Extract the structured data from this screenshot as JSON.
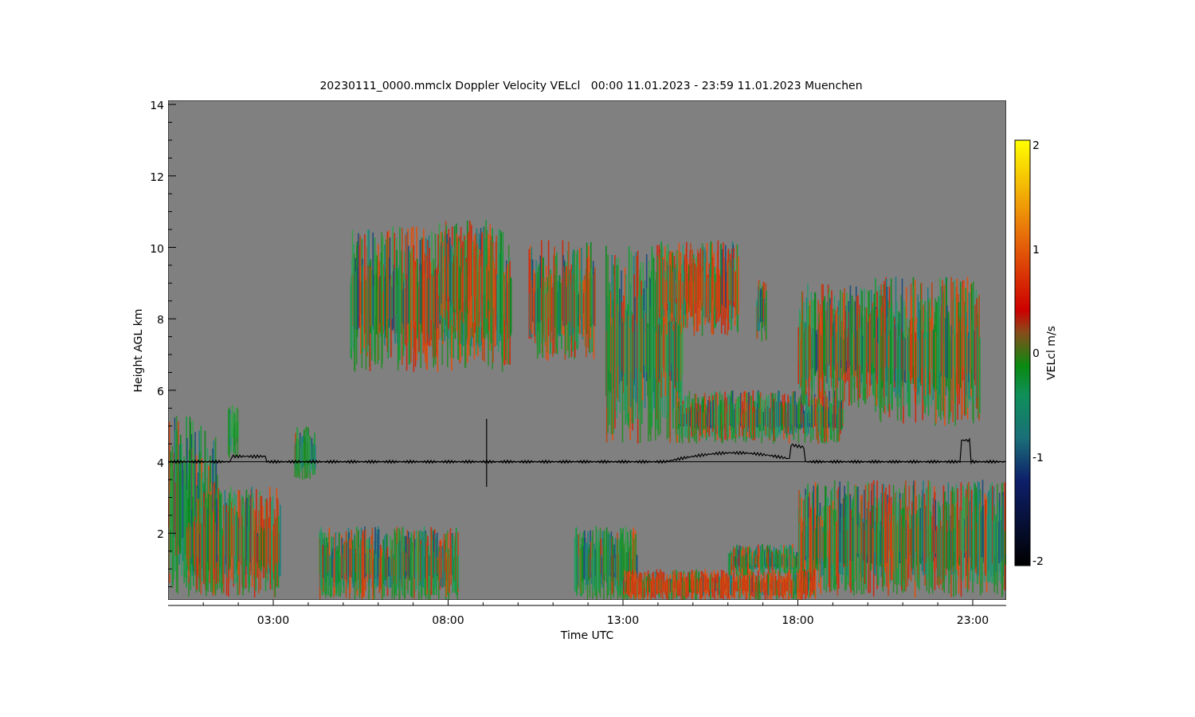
{
  "title": "20230111_0000.mmclx Doppler Velocity VELcl   00:00 11.01.2023 - 23:59 11.01.2023 Muenchen",
  "y_axis": {
    "label": "Height AGL km",
    "ticks": [
      "14",
      "12",
      "10",
      "8",
      "6",
      "4",
      "2"
    ]
  },
  "x_axis": {
    "label": "Time UTC",
    "ticks": [
      "03:00",
      "08:00",
      "13:00",
      "18:00",
      "23:00"
    ]
  },
  "colorbar": {
    "label": "VELcl m/s",
    "ticks": [
      "2",
      "1",
      "0",
      "-1",
      "-2"
    ]
  }
}
